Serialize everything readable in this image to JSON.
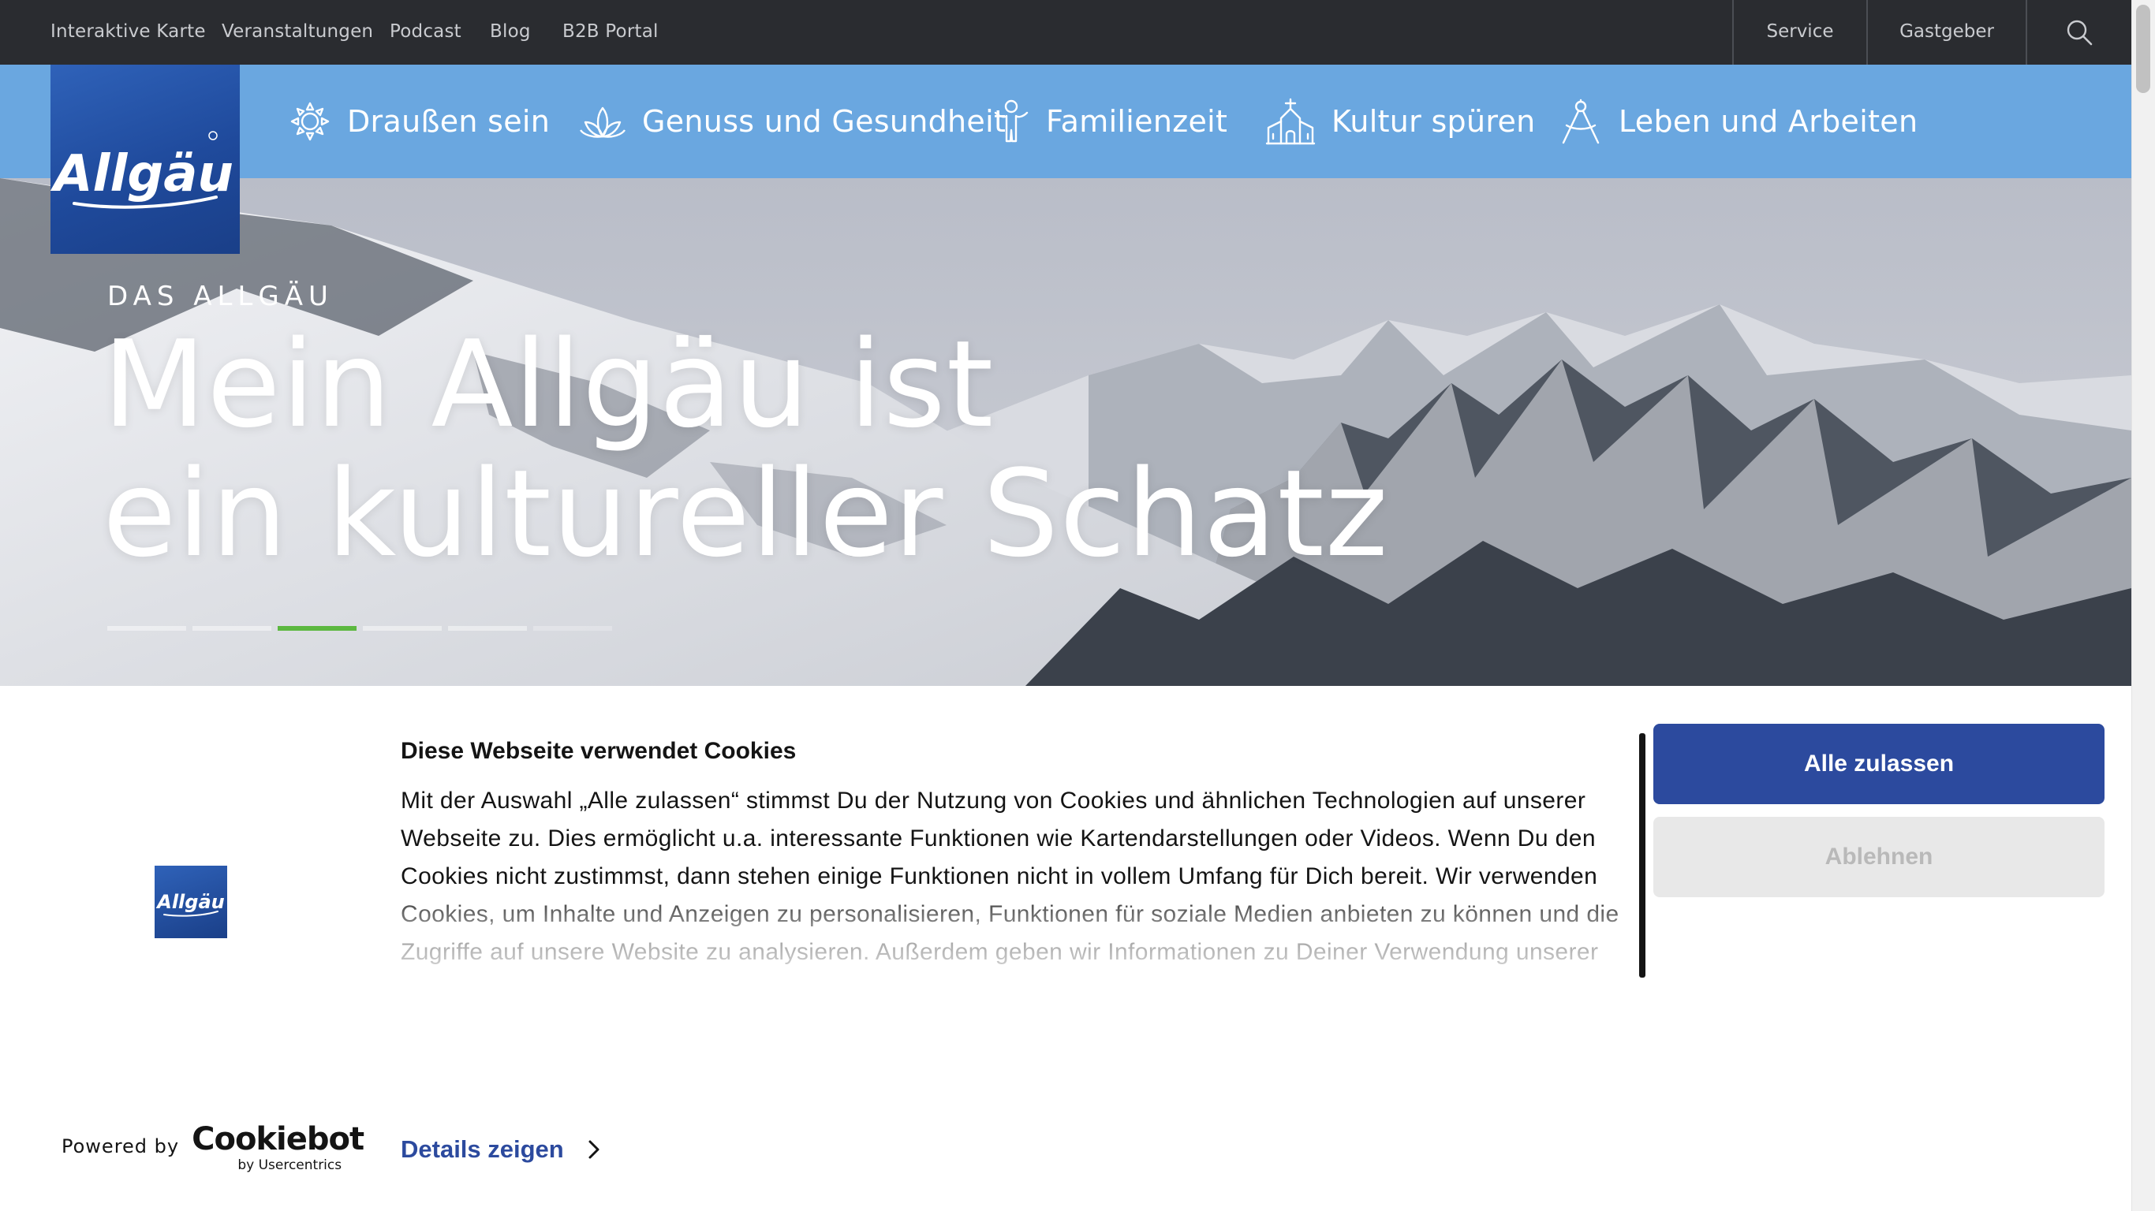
{
  "topbar": {
    "links": [
      "Interaktive Karte",
      "Veranstaltungen",
      "Podcast",
      "Blog",
      "B2B Portal"
    ],
    "right": [
      "Service",
      "Gastgeber"
    ],
    "search_icon": "search-icon"
  },
  "brand": {
    "logo_text": "Allgäu",
    "logo_color": "#1f4a9c"
  },
  "nav": {
    "items": [
      {
        "label": "Draußen sein",
        "icon": "sun-icon"
      },
      {
        "label": "Genuss und Gesundheit",
        "icon": "lotus-icon"
      },
      {
        "label": "Familienzeit",
        "icon": "child-icon"
      },
      {
        "label": "Kultur spüren",
        "icon": "church-icon"
      },
      {
        "label": "Leben und Arbeiten",
        "icon": "compass-icon"
      }
    ],
    "bar_color": "#6aa7e0"
  },
  "hero": {
    "eyebrow": "DAS ALLGÄU",
    "headline_line1": "Mein Allgäu ist",
    "headline_line2": "ein kultureller Schatz",
    "slides_total": 6,
    "active_slide": 3,
    "active_color": "#5cb840"
  },
  "cookie": {
    "title": "Diese Webseite verwendet Cookies",
    "text": "Mit der Auswahl „Alle zulassen“ stimmst Du der Nutzung von Cookies und ähnlichen Technologien auf unserer Webseite zu. Dies ermöglicht u.a. interessante Funktionen wie Kartendarstellungen oder Videos. Wenn Du den Cookies nicht zustimmst, dann stehen einige Funktionen nicht in vollem Umfang für Dich bereit. Wir verwenden Cookies, um Inhalte und Anzeigen zu personalisieren, Funktionen für soziale Medien anbieten zu können und die Zugriffe auf unsere Website zu analysieren. Außerdem geben wir Informationen zu Deiner Verwendung unserer Website an unsere Partner für soziale Medien, Werbung und Analysen weiter. Unsere Partner führen diese Informationen möglicherweise mit weiteren Daten zusammen, die Sie ihnen bereitgestellt haben oder die sie im Rahmen Ihrer Nutzung der Dienste gesammelt haben.",
    "allow_label": "Alle zulassen",
    "deny_label": "Ablehnen",
    "details_label": "Details zeigen",
    "powered_by": "Powered by",
    "provider": "Cookiebot",
    "provider_sub": "by Usercentrics",
    "accent": "#2c4a9e"
  }
}
